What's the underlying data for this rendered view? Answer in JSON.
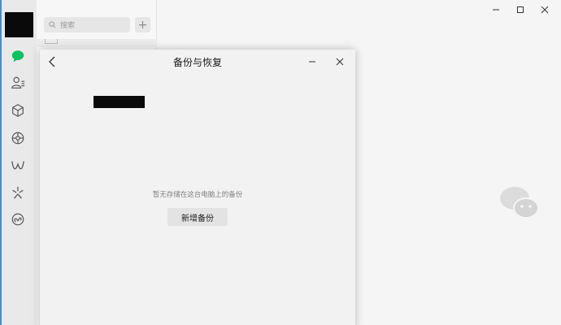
{
  "nav": {
    "icons": [
      "chat-icon",
      "contacts-icon",
      "favorites-icon",
      "moments-icon",
      "channels-icon",
      "discover-icon",
      "mini-programs-icon"
    ],
    "accent": "#07c160"
  },
  "list": {
    "search_placeholder": "搜索",
    "add_label": "+"
  },
  "dialog": {
    "title": "备份与恢复",
    "empty_message": "暂无存储在这台电脑上的备份",
    "new_backup_label": "新增备份"
  }
}
